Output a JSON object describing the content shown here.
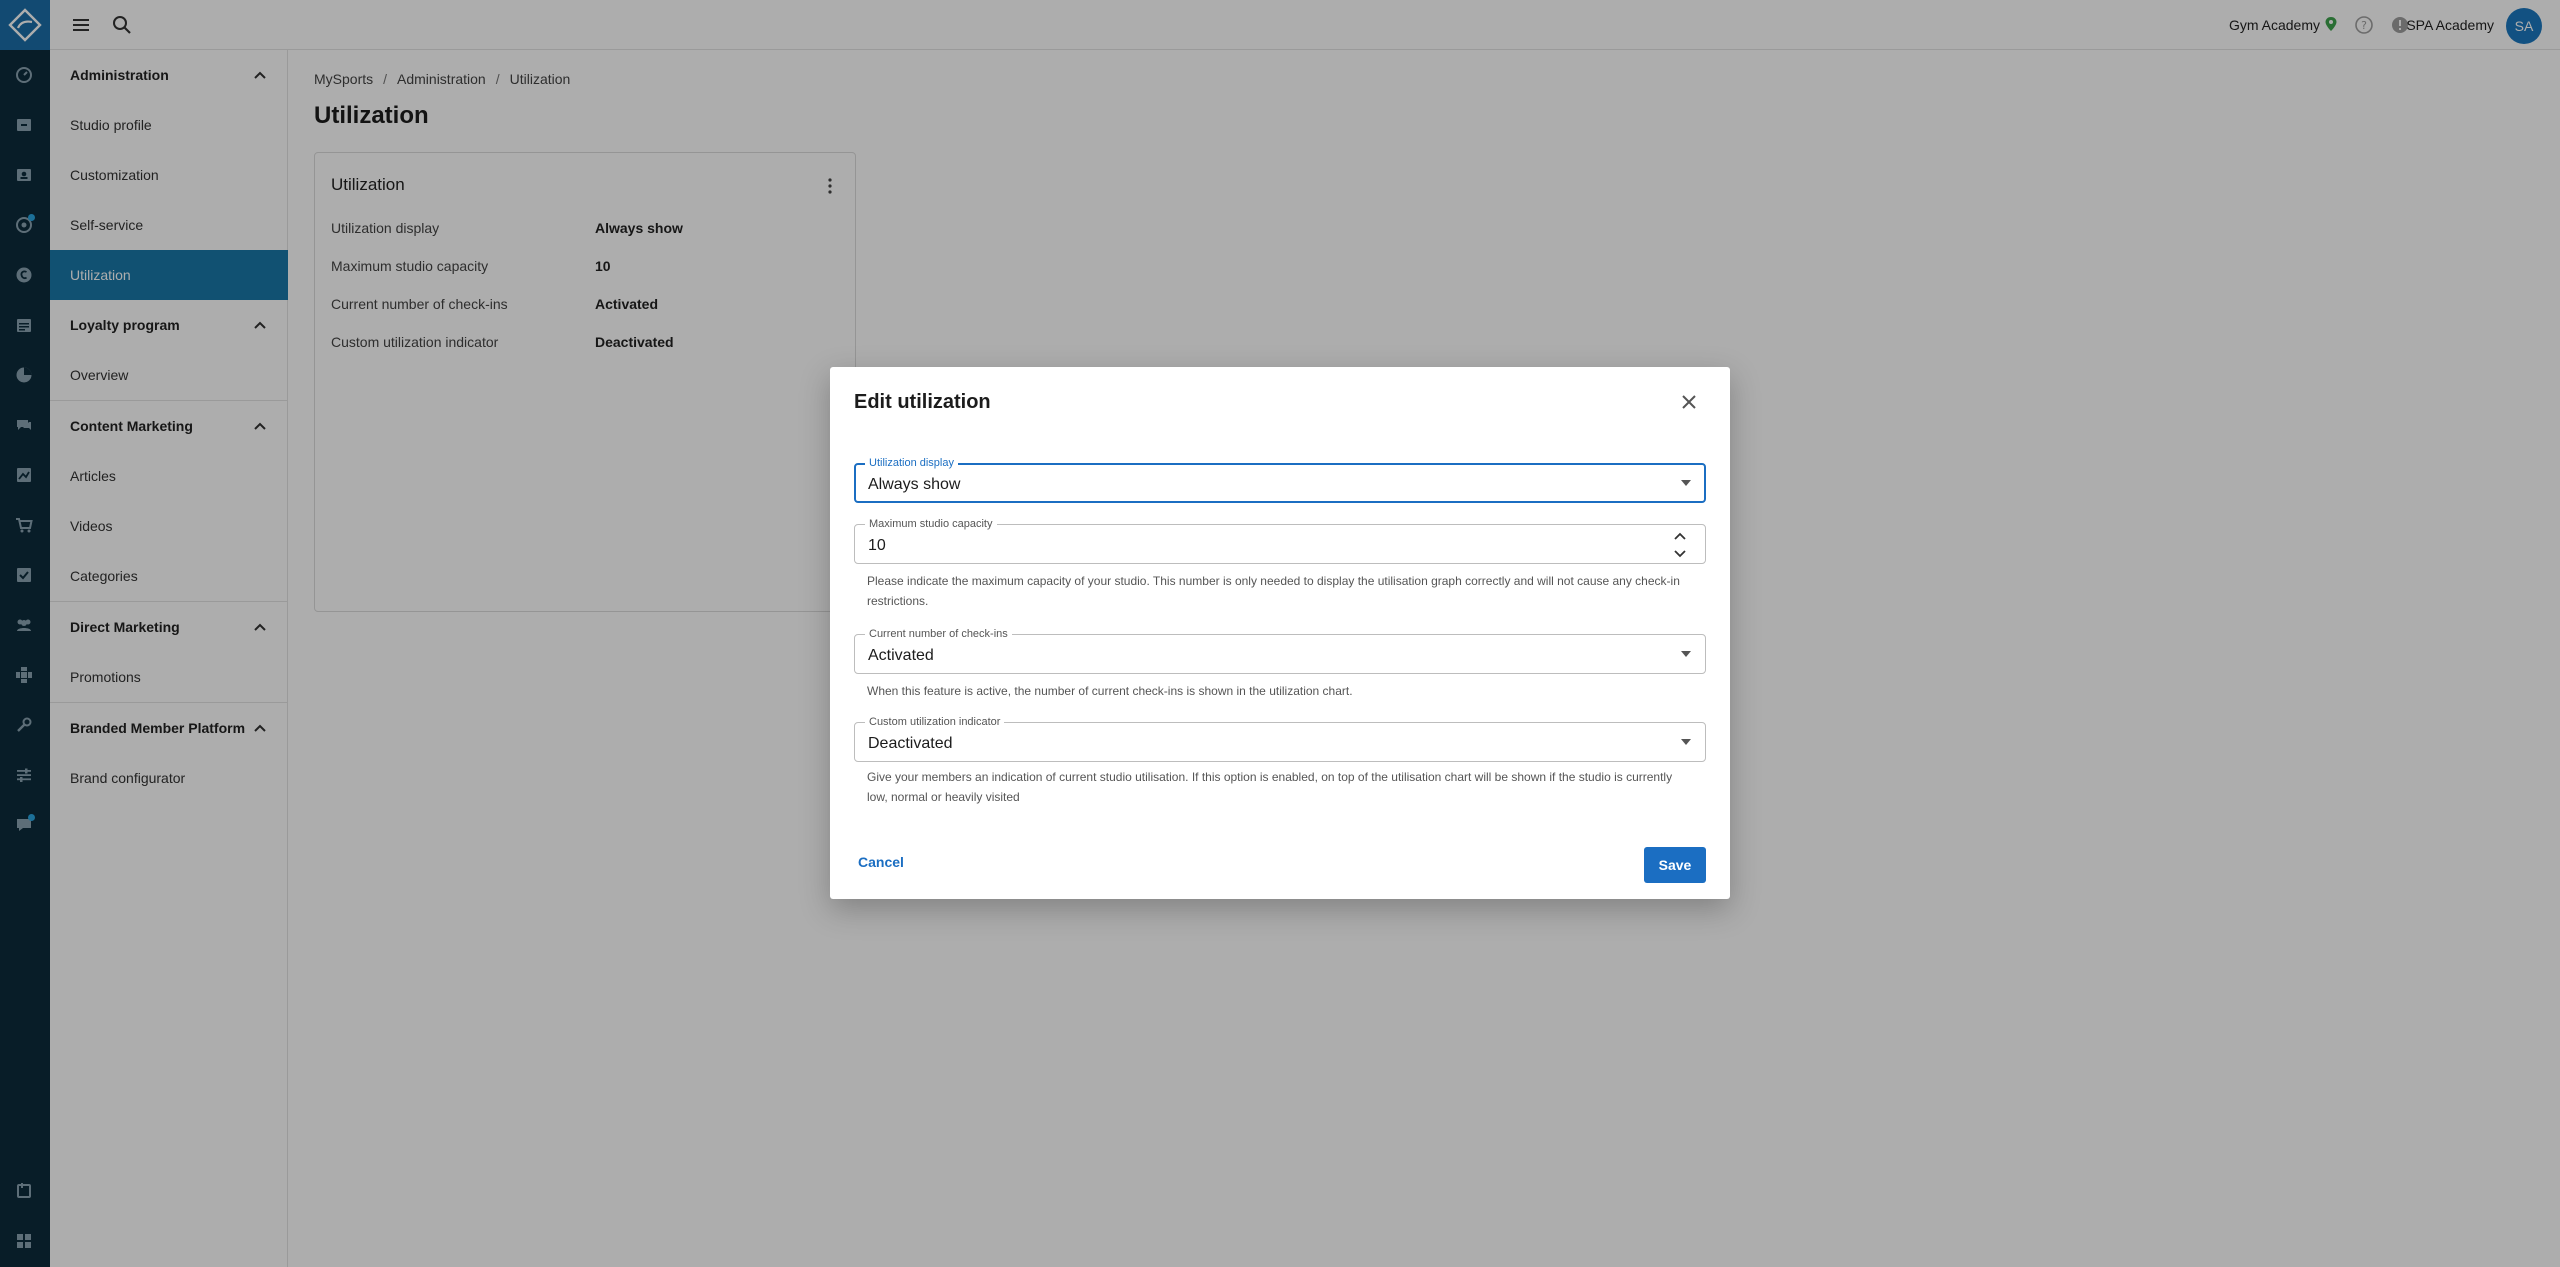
{
  "colors": {
    "rail_bg": "#0d2c3c",
    "accent": "#1b6ec2",
    "sidebar_active": "#1a78a8",
    "avatar": "#1b78c0"
  },
  "topbar": {
    "studio_name": "Gym Academy",
    "account_name": "SPA Academy",
    "avatar_initials": "SA"
  },
  "rail": {
    "icons": [
      "dashboard-icon",
      "checkin-icon",
      "contacts-icon",
      "goals-icon",
      "finance-icon",
      "calendar-icon",
      "analytics-icon",
      "chat-icon",
      "reports-icon",
      "shop-icon",
      "tasks-icon",
      "members-icon",
      "integrations-icon",
      "tools-icon",
      "settings-icon",
      "marketing-icon",
      "plugin-icon",
      "apps-icon"
    ]
  },
  "sidebar": {
    "sections": [
      {
        "title": "Administration",
        "items": [
          "Studio profile",
          "Customization",
          "Self-service",
          "Utilization"
        ]
      },
      {
        "title": "Loyalty program",
        "items": [
          "Overview"
        ]
      },
      {
        "title": "Content Marketing",
        "items": [
          "Articles",
          "Videos",
          "Categories"
        ]
      },
      {
        "title": "Direct Marketing",
        "items": [
          "Promotions"
        ]
      },
      {
        "title": "Branded Member Platform",
        "items": [
          "Brand configurator"
        ]
      }
    ],
    "active_item": "Utilization"
  },
  "breadcrumb": [
    "MySports",
    "Administration",
    "Utilization"
  ],
  "page": {
    "title": "Utilization"
  },
  "card": {
    "title": "Utilization",
    "rows": [
      {
        "label": "Utilization display",
        "value": "Always show"
      },
      {
        "label": "Maximum studio capacity",
        "value": "10"
      },
      {
        "label": "Current number of check-ins",
        "value": "Activated"
      },
      {
        "label": "Custom utilization indicator",
        "value": "Deactivated"
      }
    ]
  },
  "modal": {
    "title": "Edit utilization",
    "fields": {
      "display": {
        "label": "Utilization display",
        "value": "Always show"
      },
      "capacity": {
        "label": "Maximum studio capacity",
        "value": "10",
        "helper_line1": "Please indicate the maximum capacity of your studio. This number is only needed to display the utilisation graph correctly and will not cause any check-in",
        "helper_line2": "restrictions."
      },
      "checkins": {
        "label": "Current number of check-ins",
        "value": "Activated",
        "helper_line1": "When this feature is active, the number of current check-ins is shown in the utilization chart."
      },
      "indicator": {
        "label": "Custom utilization indicator",
        "value": "Deactivated",
        "helper_line1": "Give your members an indication of current studio utilisation. If this option is enabled, on top of the utilisation chart will be shown if the studio is currently",
        "helper_line2": "low, normal or heavily visited"
      }
    },
    "cancel_label": "Cancel",
    "save_label": "Save"
  }
}
